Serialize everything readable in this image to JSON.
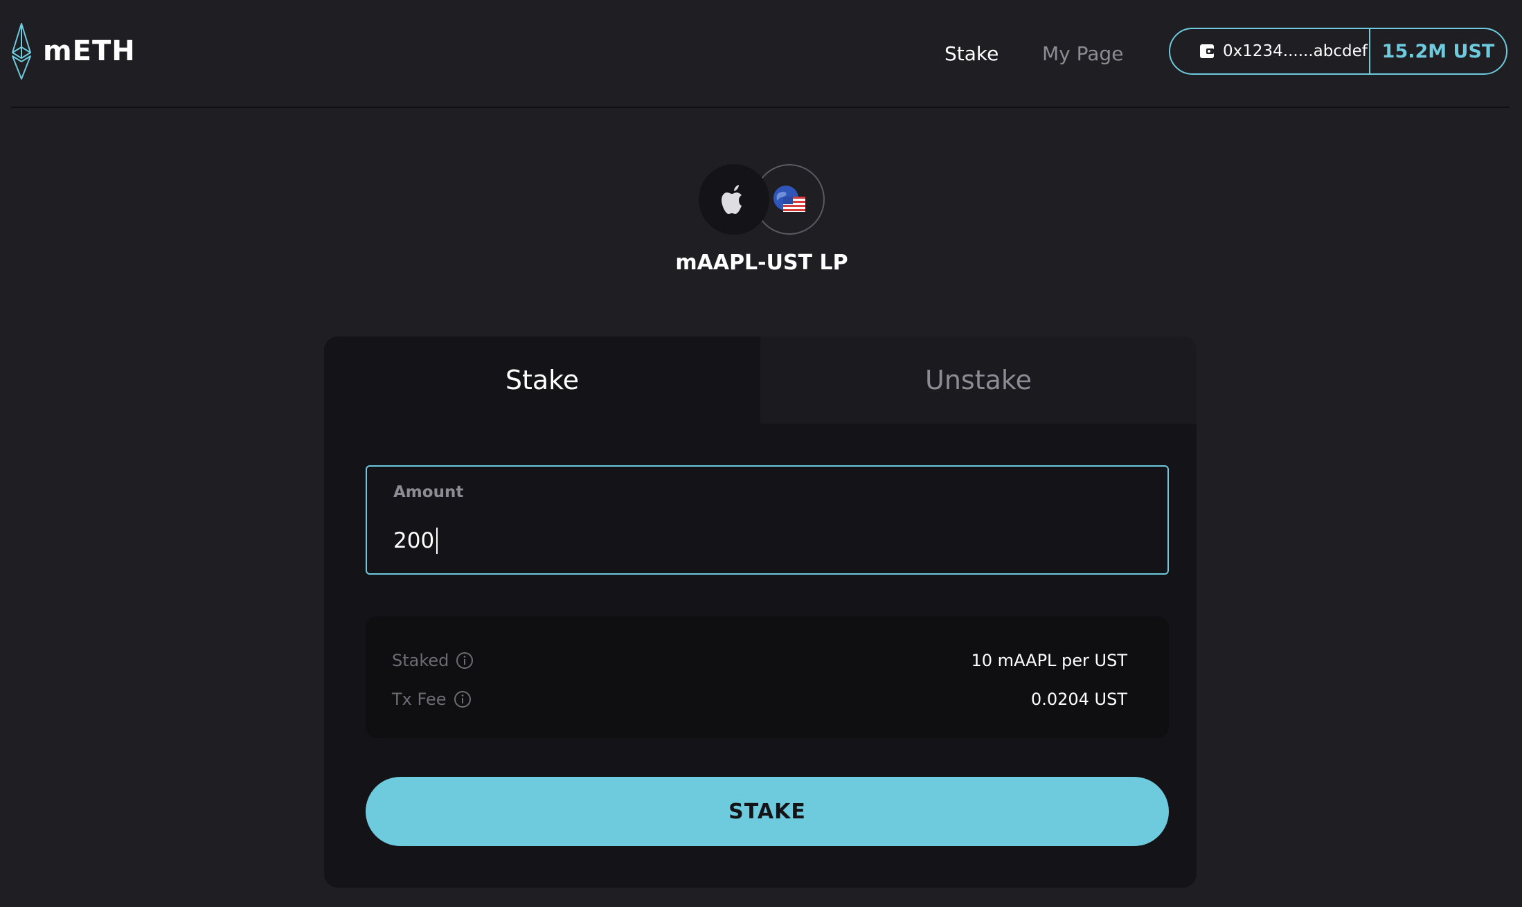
{
  "header": {
    "logo_text": "mETH",
    "nav": {
      "stake": "Stake",
      "my_page": "My Page"
    },
    "wallet": {
      "address": "0x1234......abcdef",
      "balance": "15.2M UST"
    }
  },
  "pair": {
    "title": "mAAPL-UST LP",
    "icons": [
      "apple-icon",
      "ust-globe-flag-icon"
    ]
  },
  "card": {
    "tabs": {
      "stake": "Stake",
      "unstake": "Unstake",
      "active": "Stake"
    },
    "amount": {
      "label": "Amount",
      "value": "200"
    },
    "info": [
      {
        "label": "Staked",
        "value": "10 mAAPL per UST"
      },
      {
        "label": "Tx Fee",
        "value": "0.0204 UST"
      }
    ],
    "submit_label": "STAKE"
  },
  "colors": {
    "accent": "#6ecbdd",
    "background": "#1f1e23",
    "card": "#141317"
  }
}
